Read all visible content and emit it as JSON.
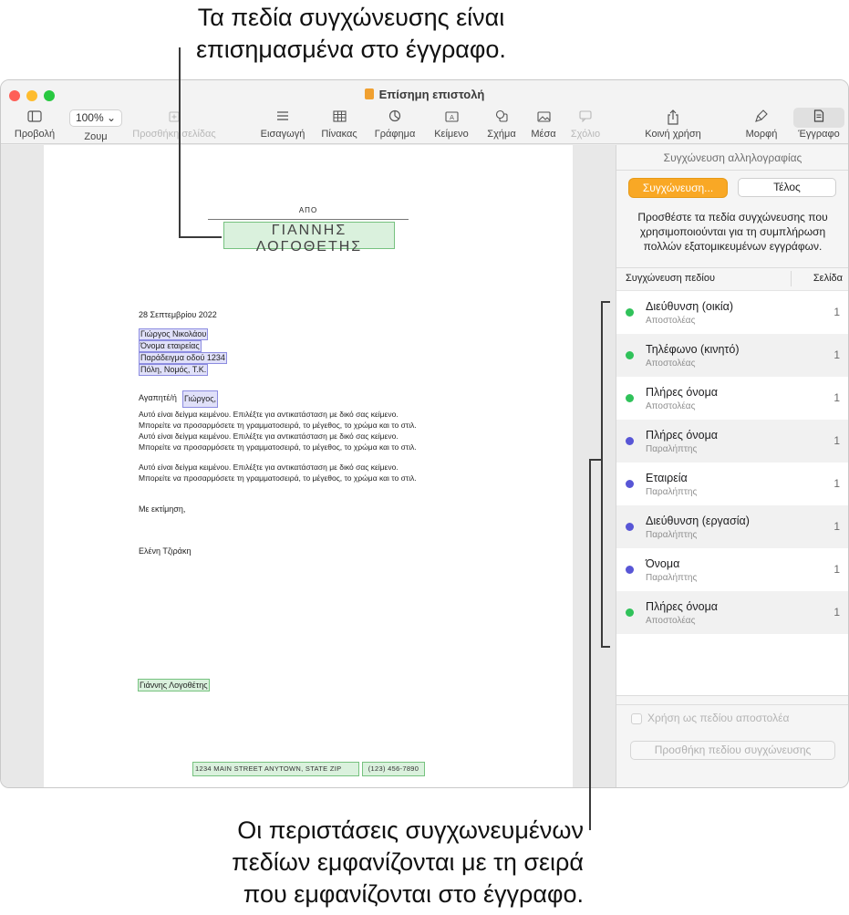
{
  "callouts": {
    "top_line1": "Τα πεδία συγχώνευσης είναι",
    "top_line2": "επισημασμένα στο έγγραφο.",
    "bottom_line1": "Οι περιστάσεις συγχωνευμένων",
    "bottom_line2": "πεδίων εμφανίζονται με τη σειρά",
    "bottom_line3": "που εμφανίζονται στο έγγραφο."
  },
  "window": {
    "title": "Επίσημη επιστολή"
  },
  "toolbar": {
    "view": "Προβολή",
    "zoom_value": "100% ⌄",
    "zoom": "Ζουμ",
    "add_page": "Προσθήκη σελίδας",
    "insert": "Εισαγωγή",
    "table": "Πίνακας",
    "chart": "Γράφημα",
    "text": "Κείμενο",
    "shape": "Σχήμα",
    "media": "Μέσα",
    "comment": "Σχόλιο",
    "share": "Κοινή χρήση",
    "format": "Μορφή",
    "document": "Έγγραφο"
  },
  "document": {
    "from_label": "ΑΠΟ",
    "sender_name": "ΓΙΑΝΝΗΣ ΛΟΓΟΘΕΤΗΣ",
    "date": "28 Σεπτεμβρίου 2022",
    "recipient_name": "Γιώργος Νικολάου",
    "company": "Όνομα εταιρείας",
    "street": "Παράδειγμα οδού 1234",
    "city": "Πόλη, Νομός, Τ.Κ.",
    "salutation": "Αγαπητέ/ή",
    "salutation_name": "Γιώργος,",
    "body": [
      "Αυτό είναι δείγμα κειμένου. Επιλέξτε για αντικατάσταση με δικό σας κείμενο.",
      "Μπορείτε να προσαρμόσετε τη γραμματοσειρά, το μέγεθος, το χρώμα και το στιλ.",
      "Αυτό είναι δείγμα κειμένου. Επιλέξτε για αντικατάσταση με δικό σας κείμενο.",
      "Μπορείτε να προσαρμόσετε τη γραμματοσειρά, το μέγεθος, το χρώμα και το στιλ.",
      "Αυτό είναι δείγμα κειμένου. Επιλέξτε για αντικατάσταση με δικό σας κείμενο.",
      "Μπορείτε να προσαρμόσετε τη γραμματοσειρά, το μέγεθος, το χρώμα και το στιλ."
    ],
    "closing": "Με εκτίμηση,",
    "signer": "Ελένη Τζιράκη",
    "sender_signature": "Γιάννης Λογοθέτης",
    "footer_address": "1234 MAIN STREET   ANYTOWN, STATE ZIP",
    "footer_phone": "(123) 456-7890"
  },
  "sidebar": {
    "title": "Συγχώνευση αλληλογραφίας",
    "tab_merge": "Συγχώνευση...",
    "tab_done": "Τέλος",
    "description": "Προσθέστε τα πεδία συγχώνευσης που χρησιμοποιούνται για τη συμπλήρωση πολλών εξατομικευμένων εγγράφων.",
    "col_field": "Συγχώνευση πεδίου",
    "col_page": "Σελίδα",
    "fields": [
      {
        "name": "Διεύθυνση (οικία)",
        "role": "Αποστολέας",
        "page": "1",
        "color": "#30c25a"
      },
      {
        "name": "Τηλέφωνο (κινητό)",
        "role": "Αποστολέας",
        "page": "1",
        "color": "#30c25a"
      },
      {
        "name": "Πλήρες όνομα",
        "role": "Αποστολέας",
        "page": "1",
        "color": "#30c25a"
      },
      {
        "name": "Πλήρες όνομα",
        "role": "Παραλήπτης",
        "page": "1",
        "color": "#5856d6"
      },
      {
        "name": "Εταιρεία",
        "role": "Παραλήπτης",
        "page": "1",
        "color": "#5856d6"
      },
      {
        "name": "Διεύθυνση (εργασία)",
        "role": "Παραλήπτης",
        "page": "1",
        "color": "#5856d6"
      },
      {
        "name": "Όνομα",
        "role": "Παραλήπτης",
        "page": "1",
        "color": "#5856d6"
      },
      {
        "name": "Πλήρες όνομα",
        "role": "Αποστολέας",
        "page": "1",
        "color": "#30c25a"
      }
    ],
    "use_as_sender": "Χρήση ως πεδίου αποστολέα",
    "add_merge_field": "Προσθήκη πεδίου συγχώνευσης"
  },
  "colors": {
    "accent": "#f9a825",
    "sender": "#30c25a",
    "recipient": "#5856d6"
  }
}
